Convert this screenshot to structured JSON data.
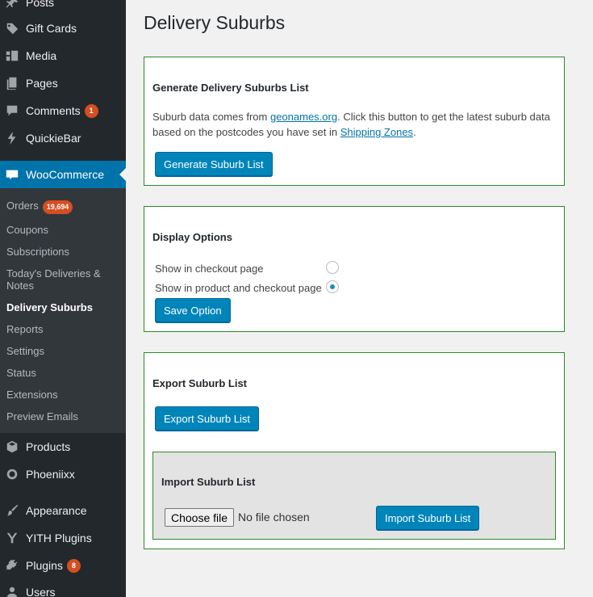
{
  "sidebar": {
    "items_top": [
      {
        "label": "Posts",
        "icon": "pin-icon"
      },
      {
        "label": "Gift Cards",
        "icon": "tag-icon"
      },
      {
        "label": "Media",
        "icon": "media-icon"
      },
      {
        "label": "Pages",
        "icon": "pages-icon"
      },
      {
        "label": "Comments",
        "icon": "comment-icon",
        "badge": "1"
      },
      {
        "label": "QuickieBar",
        "icon": "bolt-icon"
      }
    ],
    "woocommerce": {
      "label": "WooCommerce",
      "icon_text": "WOO"
    },
    "submenu": [
      {
        "label": "Orders",
        "badge": "19,694"
      },
      {
        "label": "Coupons"
      },
      {
        "label": "Subscriptions"
      },
      {
        "label": "Today's Deliveries & Notes"
      },
      {
        "label": "Delivery Suburbs",
        "current": true
      },
      {
        "label": "Reports"
      },
      {
        "label": "Settings"
      },
      {
        "label": "Status"
      },
      {
        "label": "Extensions"
      },
      {
        "label": "Preview Emails"
      }
    ],
    "items_bottom": [
      {
        "label": "Products",
        "icon": "box-icon"
      },
      {
        "label": "Phoeniixx",
        "icon": "circle-icon"
      },
      {
        "label": "Appearance",
        "icon": "brush-icon"
      },
      {
        "label": "YITH Plugins",
        "icon": "yith-icon"
      },
      {
        "label": "Plugins",
        "icon": "plug-icon",
        "badge": "8"
      },
      {
        "label": "Users",
        "icon": "user-icon"
      }
    ]
  },
  "page": {
    "title": "Delivery Suburbs"
  },
  "generate": {
    "title": "Generate Delivery Suburbs List",
    "text_before": "Suburb data comes from ",
    "link1": "geonames.org",
    "text_middle": ". Click this button to get the latest suburb data based on the postcodes you have set in ",
    "link2": "Shipping Zones",
    "text_after": ".",
    "button": "Generate Suburb List"
  },
  "display": {
    "title": "Display Options",
    "option1": "Show in checkout page",
    "option2": "Show in product and checkout page",
    "selected": "option2",
    "button": "Save Option"
  },
  "export": {
    "title": "Export Suburb List",
    "button": "Export Suburb List"
  },
  "import": {
    "title": "Import Suburb List",
    "choose_file": "Choose file",
    "file_status": "No file chosen",
    "button": "Import Suburb List"
  },
  "colors": {
    "sidebar_bg": "#23282d",
    "submenu_bg": "#32373c",
    "active_bg": "#0073aa",
    "button_bg": "#0085ba",
    "badge_bg": "#d54e21",
    "panel_border": "#2a8a2a"
  }
}
